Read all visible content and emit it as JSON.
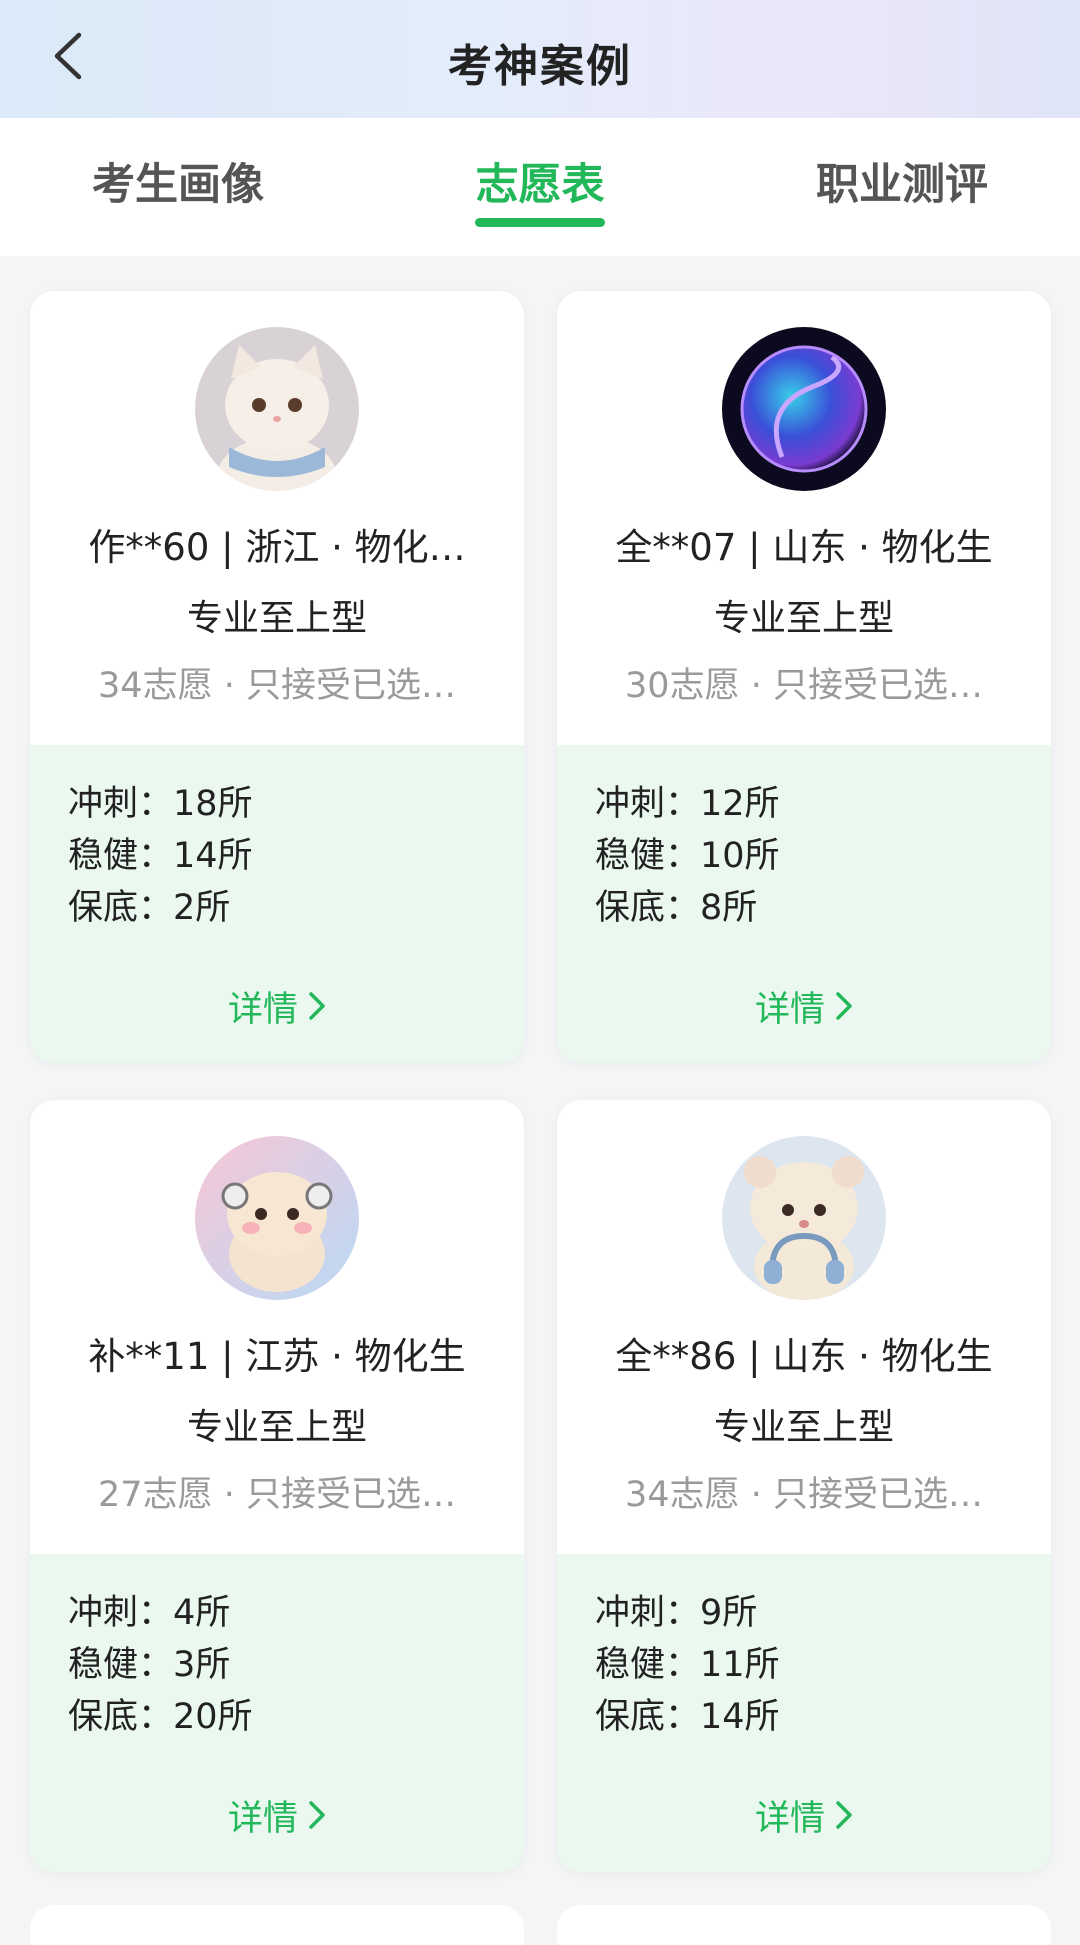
{
  "header": {
    "title": "考神案例"
  },
  "tabs": [
    {
      "label": "考生画像",
      "active": false
    },
    {
      "label": "志愿表",
      "active": true
    },
    {
      "label": "职业测评",
      "active": false
    }
  ],
  "cards": [
    {
      "name": "作**60 | 浙江 · 物化…",
      "type": "专业至上型",
      "desc": "34志愿 · 只接受已选…",
      "chongci": "冲刺：18所",
      "wenjian": "稳健：14所",
      "baodi": "保底：2所",
      "detail": "详情",
      "avatar": "cat-avatar"
    },
    {
      "name": "全**07 | 山东 · 物化生",
      "type": "专业至上型",
      "desc": "30志愿 · 只接受已选…",
      "chongci": "冲刺：12所",
      "wenjian": "稳健：10所",
      "baodi": "保底：8所",
      "detail": "详情",
      "avatar": "orb-avatar"
    },
    {
      "name": "补**11 | 江苏 · 物化生",
      "type": "专业至上型",
      "desc": "27志愿 · 只接受已选…",
      "chongci": "冲刺：4所",
      "wenjian": "稳健：3所",
      "baodi": "保底：20所",
      "detail": "详情",
      "avatar": "hamster-avatar"
    },
    {
      "name": "全**86 | 山东 · 物化生",
      "type": "专业至上型",
      "desc": "34志愿 · 只接受已选…",
      "chongci": "冲刺：9所",
      "wenjian": "稳健：11所",
      "baodi": "保底：14所",
      "detail": "详情",
      "avatar": "bear-headphones-avatar"
    }
  ],
  "colors": {
    "accent": "#22b85a",
    "stats_bg": "#ebf8f0"
  }
}
